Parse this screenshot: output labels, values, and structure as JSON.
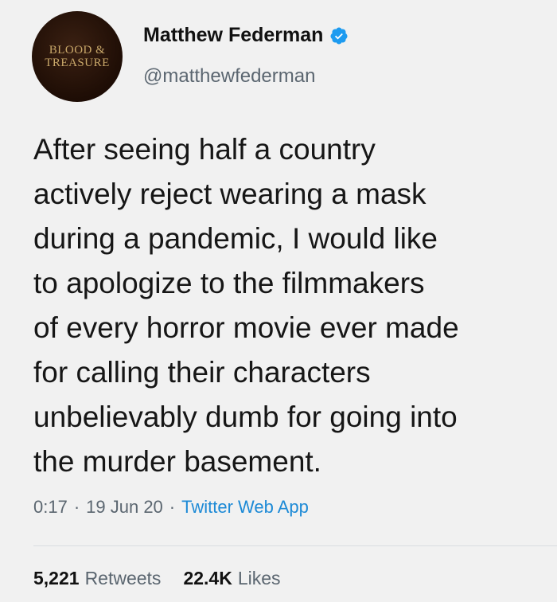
{
  "user": {
    "name": "Matthew Federman",
    "handle": "@matthewfederman",
    "avatar_text_line1": "BLOOD & ",
    "avatar_text_line2": "TREASURE",
    "verified_color": "#1d9bf0"
  },
  "tweet": {
    "text": "After seeing half a country\nactively reject wearing a mask\nduring a pandemic, I would like\nto apologize to the filmmakers\nof every horror movie ever made\nfor calling their characters\nunbelievably dumb for going into\nthe murder basement."
  },
  "meta": {
    "time": "0:17",
    "date": "19 Jun 20",
    "separator": "·",
    "source": "Twitter Web App"
  },
  "stats": {
    "retweets_count": "5,221",
    "retweets_label": "Retweets",
    "likes_count": "22.4K",
    "likes_label": "Likes"
  }
}
